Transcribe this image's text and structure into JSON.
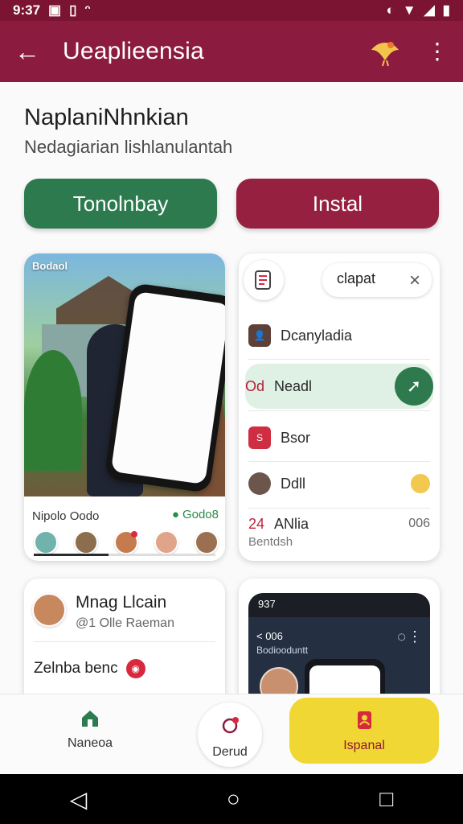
{
  "status_bar": {
    "time": "9:37",
    "icons": [
      "image-icon",
      "battery-icon",
      "bluetooth-icon",
      "wifi-icon",
      "signal-icon",
      "battery-full-icon"
    ]
  },
  "app_bar": {
    "title": "Ueaplieensia",
    "back_icon": "arrow-left-icon",
    "logo_icon": "bird-logo-icon",
    "menu_icon": "more-vert-icon"
  },
  "header": {
    "title": "NaplaniNhnkian",
    "subtitle": "Nedagiarian lishlanulantah"
  },
  "actions": {
    "primary_label": "Tonolnbay",
    "secondary_label": "Instal"
  },
  "photo_card": {
    "overlay_text": "Bodaol",
    "footer_left": "Nipolo Oodo",
    "footer_right": "Godo8",
    "progress_fraction": 0.41
  },
  "menu_card": {
    "search_text": "clapat",
    "items": [
      {
        "label": "Dcanyladia",
        "icon": "person-icon"
      },
      {
        "prefix": "Od",
        "label": "Neadl",
        "icon": "share-icon"
      },
      {
        "badge": "S",
        "label": "Bsor",
        "icon": "tag-icon"
      },
      {
        "label": "Ddll",
        "icon": "avatar-icon"
      },
      {
        "number": "24",
        "label": "ANlia",
        "time": "006",
        "subtext": "Bentdsh"
      }
    ]
  },
  "profile_card": {
    "name": "Mnag Llcain",
    "handle": "@1 Olle Raeman",
    "line": "Zelnba benc"
  },
  "device_card": {
    "time": "937",
    "app_title": "< 006",
    "app_subtitle": "Bodiooduntt"
  },
  "bottom_nav": {
    "items": [
      {
        "label": "Naneoa",
        "icon": "home-icon"
      },
      {
        "label": "Derud",
        "icon": "chat-icon"
      },
      {
        "label": "Ispanal",
        "icon": "profile-document-icon"
      }
    ]
  },
  "system_nav": [
    "back-triangle-icon",
    "home-circle-icon",
    "recent-square-icon"
  ]
}
